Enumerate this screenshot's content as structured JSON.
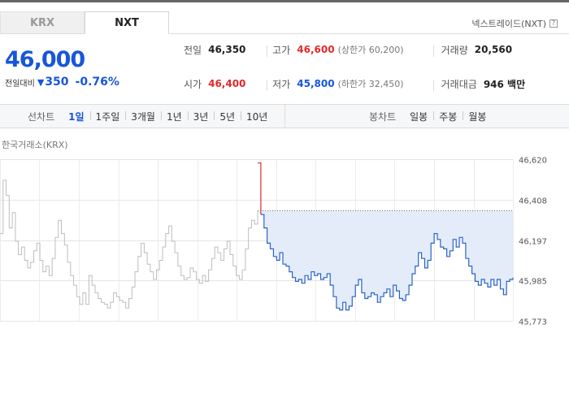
{
  "tabs": [
    {
      "label": "KRX",
      "active": false
    },
    {
      "label": "NXT",
      "active": true
    }
  ],
  "nxt_link": {
    "label": "넥스트레이드(NXT)",
    "help_icon": "?"
  },
  "quote": {
    "price": "46,000",
    "change_label": "전일대비",
    "direction_icon": "down-triangle",
    "change": "350",
    "change_pct": "-0.76%"
  },
  "info": {
    "row1": [
      {
        "label": "전일",
        "value": "46,350"
      },
      {
        "label": "고가",
        "value": "46,600",
        "sub": "(상한가 60,200)"
      },
      {
        "label": "거래량",
        "value": "20,560"
      }
    ],
    "row2": [
      {
        "label": "시가",
        "value": "46,400"
      },
      {
        "label": "저가",
        "value": "45,800",
        "sub": "(하한가 32,450)"
      },
      {
        "label": "거래대금",
        "value": "946 백만"
      }
    ]
  },
  "period_bar": {
    "line_title": "선차트",
    "line_periods": [
      "1일",
      "1주일",
      "3개월",
      "1년",
      "3년",
      "5년",
      "10년"
    ],
    "active_period": "1일",
    "candle_title": "봉차트",
    "candle_periods": [
      "일봉",
      "주봉",
      "월봉"
    ]
  },
  "chart_label": "한국거래소(KRX)",
  "colors": {
    "price_down": "#1856d8",
    "price_up": "#e12a2a",
    "krx_line": "#bdbdbd",
    "nxt_line": "#2c64c8",
    "fill": "#e4ecfa"
  },
  "chart_data": {
    "type": "line",
    "ylim": [
      45773,
      46620
    ],
    "yticks": [
      "46,620",
      "46,408",
      "46,197",
      "45,985",
      "45,773"
    ],
    "reference_value": 46350,
    "series": [
      {
        "name": "한국거래소(KRX)",
        "values": [
          46230,
          46510,
          46430,
          46260,
          46340,
          46190,
          46120,
          46160,
          46090,
          46050,
          46080,
          46140,
          46180,
          46090,
          46030,
          46060,
          46010,
          46100,
          46210,
          46300,
          46230,
          46170,
          46080,
          46010,
          45960,
          45900,
          45860,
          45920,
          45860,
          46010,
          45960,
          45920,
          45890,
          45870,
          45860,
          45840,
          45870,
          45920,
          45900,
          45880,
          45870,
          45840,
          45890,
          45950,
          46030,
          46110,
          46180,
          46130,
          46070,
          46030,
          45990,
          46040,
          46090,
          46160,
          46230,
          46270,
          46190,
          46130,
          46060,
          46010,
          45990,
          46000,
          46050,
          46030,
          45990,
          45970,
          46010,
          45980,
          46040,
          46100,
          46160,
          46130,
          46090,
          46150,
          46190,
          46120,
          46060,
          46010,
          45990,
          46040,
          46150,
          46260,
          46300,
          46280,
          46350
        ]
      },
      {
        "name": "넥스트레이드(NXT)",
        "values": [
          46600,
          46330,
          46260,
          46180,
          46150,
          46110,
          46090,
          46130,
          46070,
          46060,
          46030,
          46000,
          45980,
          45990,
          45970,
          46010,
          45990,
          46030,
          46010,
          46020,
          45990,
          46000,
          46020,
          45960,
          45900,
          45840,
          45830,
          45870,
          45830,
          45850,
          45900,
          45960,
          45990,
          45920,
          45890,
          45900,
          45920,
          45910,
          45870,
          45900,
          45920,
          45940,
          45900,
          45960,
          45930,
          45890,
          45880,
          45910,
          45960,
          46020,
          46060,
          46130,
          46100,
          46050,
          46090,
          46180,
          46230,
          46200,
          46160,
          46150,
          46110,
          46140,
          46200,
          46160,
          46210,
          46180,
          46100,
          46060,
          46020,
          45980,
          45960,
          45990,
          45970,
          45950,
          45990,
          45960,
          45990,
          45940,
          45910,
          45980,
          45990,
          46000
        ]
      }
    ]
  }
}
